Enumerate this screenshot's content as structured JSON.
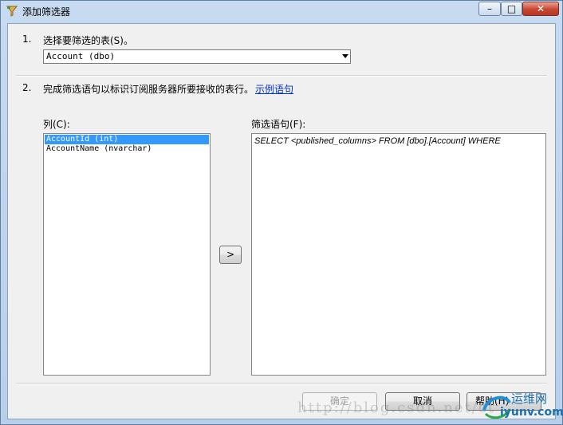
{
  "window": {
    "title": "添加筛选器",
    "minimize_glyph": "–",
    "maximize_glyph": "□",
    "close_glyph": "✕"
  },
  "step1": {
    "number": "1.",
    "label": "选择要筛选的表(S)。",
    "table_combo": {
      "selected": "Account (dbo)"
    }
  },
  "step2": {
    "number": "2.",
    "label": "完成筛选语句以标识订阅服务器所要接收的表行。",
    "link_text": "示例语句"
  },
  "columns": {
    "label": "列(C):",
    "items": [
      {
        "text": "AccountId (int)",
        "selected": true
      },
      {
        "text": "AccountName (nvarchar)",
        "selected": false
      }
    ]
  },
  "add_button": {
    "label": ">"
  },
  "filter": {
    "label": "筛选语句(F):",
    "statement": "SELECT <published_columns> FROM [dbo].[Account] WHERE"
  },
  "buttons": {
    "ok": "确定",
    "cancel": "取消",
    "help": "帮助(H)"
  },
  "overlay": {
    "watermark": "http://blog.csdn.net/ct",
    "logo_top": "运维网",
    "logo_bottom": "iyunv.com"
  },
  "colors": {
    "selection": "#3399ff",
    "link": "#0033cc",
    "title_close": "#c7452f"
  }
}
